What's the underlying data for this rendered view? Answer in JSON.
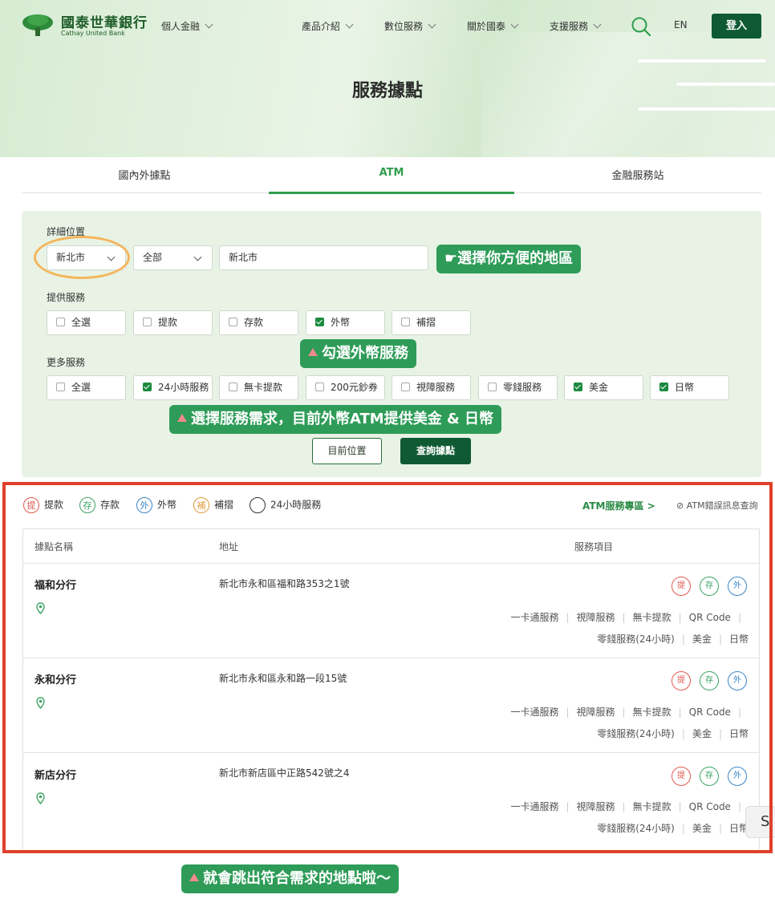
{
  "header": {
    "bank_name_cn": "國泰世華銀行",
    "bank_name_en": "Cathay United Bank",
    "segment": "個人金融",
    "nav": [
      "產品介紹",
      "數位服務",
      "關於國泰",
      "支援服務"
    ],
    "lang": "EN",
    "login": "登入"
  },
  "page_title": "服務據點",
  "tabs": [
    "國內外據點",
    "ATM",
    "金融服務站"
  ],
  "active_tab": "ATM",
  "filter": {
    "location_label": "詳細位置",
    "city": "新北市",
    "district": "全部",
    "address_value": "新北市",
    "provide_label": "提供服務",
    "provide_options": [
      {
        "label": "全選",
        "checked": false
      },
      {
        "label": "提款",
        "checked": false
      },
      {
        "label": "存款",
        "checked": false
      },
      {
        "label": "外幣",
        "checked": true
      },
      {
        "label": "補摺",
        "checked": false
      }
    ],
    "more_label": "更多服務",
    "more_options": [
      {
        "label": "全選",
        "checked": false
      },
      {
        "label": "24小時服務",
        "checked": true
      },
      {
        "label": "無卡提款",
        "checked": false
      },
      {
        "label": "200元鈔券",
        "checked": false
      },
      {
        "label": "視障服務",
        "checked": false
      },
      {
        "label": "零錢服務",
        "checked": false
      },
      {
        "label": "美金",
        "checked": true
      },
      {
        "label": "日幣",
        "checked": true
      }
    ],
    "current_location_btn": "目前位置",
    "search_btn": "查詢據點"
  },
  "annotations": {
    "choose_area": "選擇你方便的地區",
    "check_fx": "勾選外幣服務",
    "choose_needs": "選擇服務需求，目前外幣ATM提供美金 & 日幣",
    "results": "就會跳出符合需求的地點啦～"
  },
  "legend": {
    "items": [
      {
        "icon": "提",
        "label": "提款",
        "color": "#e2594f"
      },
      {
        "icon": "存",
        "label": "存款",
        "color": "#3aa463"
      },
      {
        "icon": "外",
        "label": "外幣",
        "color": "#3a86c8"
      },
      {
        "icon": "補",
        "label": "補摺",
        "color": "#e39a3c"
      },
      {
        "icon": "",
        "label": "24小時服務",
        "color": "#333333"
      }
    ],
    "atm_zone": "ATM服務專區",
    "atm_error": "ATM錯誤訊息查詢"
  },
  "table": {
    "headers": [
      "據點名稱",
      "地址",
      "服務項目"
    ],
    "service_icons": [
      {
        "text": "提",
        "color": "#e2594f"
      },
      {
        "text": "存",
        "color": "#3aa463"
      },
      {
        "text": "外",
        "color": "#3a86c8"
      }
    ],
    "rows": [
      {
        "name": "福和分行",
        "address": "新北市永和區福和路353之1號",
        "line1": [
          "一卡通服務",
          "視障服務",
          "無卡提款",
          "QR Code"
        ],
        "line2": [
          "零錢服務(24小時)",
          "美金",
          "日幣"
        ]
      },
      {
        "name": "永和分行",
        "address": "新北市永和區永和路一段15號",
        "line1": [
          "一卡通服務",
          "視障服務",
          "無卡提款",
          "QR Code"
        ],
        "line2": [
          "零錢服務(24小時)",
          "美金",
          "日幣"
        ]
      },
      {
        "name": "新店分行",
        "address": "新北市新店區中正路542號之4",
        "line1": [
          "一卡通服務",
          "視障服務",
          "無卡提款",
          "QR Code"
        ],
        "line2": [
          "零錢服務(24小時)",
          "美金",
          "日幣"
        ]
      }
    ]
  },
  "side_tab": "S"
}
